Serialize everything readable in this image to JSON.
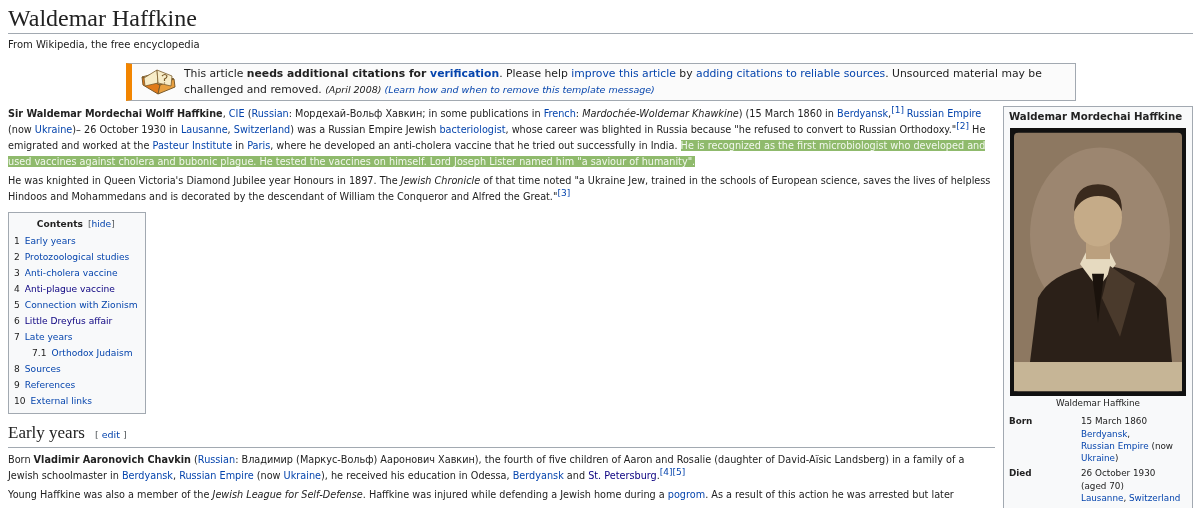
{
  "page": {
    "title": "Waldemar Haffkine",
    "tagline": "From Wikipedia, the free encyclopedia"
  },
  "notice": {
    "segments": [
      {
        "kind": "text",
        "text": "This article "
      },
      {
        "kind": "bold",
        "text": "needs additional citations for "
      },
      {
        "kind": "bold-link",
        "text": "verification"
      },
      {
        "kind": "text",
        "text": ". Please help "
      },
      {
        "kind": "link",
        "text": "improve this article"
      },
      {
        "kind": "text",
        "text": " by "
      },
      {
        "kind": "link",
        "text": "adding citations to reliable sources"
      },
      {
        "kind": "text",
        "text": ". Unsourced material may be challenged and removed. "
      },
      {
        "kind": "small-italic",
        "text": "(April 2008) "
      },
      {
        "kind": "small-link",
        "text": "(Learn how and when to remove this template message)"
      }
    ]
  },
  "intro": [
    {
      "segments": [
        {
          "kind": "bold",
          "text": "Sir Waldemar Mordechai Wolff Haffkine"
        },
        {
          "kind": "text",
          "text": ", "
        },
        {
          "kind": "link",
          "text": "CIE"
        },
        {
          "kind": "text",
          "text": " ("
        },
        {
          "kind": "link",
          "text": "Russian"
        },
        {
          "kind": "text",
          "text": ": Мордехай-Вольф Хавкин; in some publications in "
        },
        {
          "kind": "link",
          "text": "French"
        },
        {
          "kind": "text",
          "text": ": "
        },
        {
          "kind": "italic",
          "text": "Mardochée-Woldemar Khawkine"
        },
        {
          "kind": "text",
          "text": ") (15 March 1860 in "
        },
        {
          "kind": "link",
          "text": "Berdyansk"
        },
        {
          "kind": "text",
          "text": ","
        },
        {
          "kind": "citation",
          "text": "[1] "
        },
        {
          "kind": "link",
          "text": "Russian Empire"
        },
        {
          "kind": "text",
          "text": " (now "
        },
        {
          "kind": "link",
          "text": "Ukraine"
        },
        {
          "kind": "text",
          "text": ")– 26 October 1930 in "
        },
        {
          "kind": "link",
          "text": "Lausanne"
        },
        {
          "kind": "text",
          "text": ", "
        },
        {
          "kind": "link",
          "text": "Switzerland"
        },
        {
          "kind": "text",
          "text": ") was a Russian Empire Jewish "
        },
        {
          "kind": "link",
          "text": "bacteriologist"
        },
        {
          "kind": "text",
          "text": ", whose career was blighted in Russia because \"he refused to convert to Russian Orthodoxy.\""
        },
        {
          "kind": "citation",
          "text": "[2]"
        },
        {
          "kind": "text",
          "text": " He emigrated and worked at the "
        },
        {
          "kind": "link",
          "text": "Pasteur Institute"
        },
        {
          "kind": "text",
          "text": " in "
        },
        {
          "kind": "link",
          "text": "Paris"
        },
        {
          "kind": "text",
          "text": ", where he developed an anti-cholera vaccine that he tried out successfully in India. "
        },
        {
          "kind": "highlight",
          "text": "He is recognized as the first microbiologist who developed and used vaccines against cholera and bubonic plague. He tested the vaccines on himself. Lord Joseph Lister named him \"a saviour of humanity\"."
        }
      ]
    },
    {
      "segments": [
        {
          "kind": "text",
          "text": "He was knighted in Queen Victoria's Diamond Jubilee year Honours in 1897. The "
        },
        {
          "kind": "italic",
          "text": "Jewish Chronicle"
        },
        {
          "kind": "text",
          "text": " of that time noted \"a Ukraine Jew, trained in the schools of European science, saves the lives of helpless Hindoos and Mohammedans and is decorated by the descendant of William the Conqueror and Alfred the Great.\""
        },
        {
          "kind": "citation",
          "text": "[3]"
        }
      ]
    }
  ],
  "toc": {
    "title": "Contents",
    "toggle": {
      "open": "[",
      "label": "hide",
      "close": "]"
    },
    "items": [
      {
        "number": "1",
        "label": "Early years",
        "visited": false
      },
      {
        "number": "2",
        "label": "Protozoological studies",
        "visited": false
      },
      {
        "number": "3",
        "label": "Anti-cholera vaccine",
        "visited": false
      },
      {
        "number": "4",
        "label": "Anti-plague vaccine",
        "visited": true
      },
      {
        "number": "5",
        "label": "Connection with Zionism",
        "visited": false
      },
      {
        "number": "6",
        "label": "Little Dreyfus affair",
        "visited": true
      },
      {
        "number": "7",
        "label": "Late years",
        "visited": false,
        "children": [
          {
            "number": "7.1",
            "label": "Orthodox Judaism",
            "visited": false
          }
        ]
      },
      {
        "number": "8",
        "label": "Sources",
        "visited": false
      },
      {
        "number": "9",
        "label": "References",
        "visited": false
      },
      {
        "number": "10",
        "label": "External links",
        "visited": false
      }
    ]
  },
  "section": {
    "heading": "Early years",
    "edit": {
      "open": "[",
      "label": "edit",
      "close": "]"
    },
    "paragraphs": [
      {
        "segments": [
          {
            "kind": "text",
            "text": "Born "
          },
          {
            "kind": "bold",
            "text": "Vladimir Aaronovich Chavkin"
          },
          {
            "kind": "text",
            "text": " ("
          },
          {
            "kind": "link",
            "text": "Russian"
          },
          {
            "kind": "text",
            "text": ": Владимир (Маркус-Вольф) Ааронович Хавкин), the fourth of five children of Aaron and Rosalie (daughter of David-Aïsic Landsberg) in a family of a Jewish schoolmaster in "
          },
          {
            "kind": "link",
            "text": "Berdyansk"
          },
          {
            "kind": "text",
            "text": ", "
          },
          {
            "kind": "link",
            "text": "Russian Empire"
          },
          {
            "kind": "text",
            "text": " (now "
          },
          {
            "kind": "link",
            "text": "Ukraine"
          },
          {
            "kind": "text",
            "text": "), he received his education in Odessa, "
          },
          {
            "kind": "link",
            "text": "Berdyansk"
          },
          {
            "kind": "text",
            "text": " and "
          },
          {
            "kind": "visited-link",
            "text": "St. Petersburg"
          },
          {
            "kind": "text",
            "text": "."
          },
          {
            "kind": "citation",
            "text": "[4]"
          },
          {
            "kind": "citation",
            "text": "[5]"
          }
        ]
      },
      {
        "segments": [
          {
            "kind": "text",
            "text": "Young Haffkine was also a member of the "
          },
          {
            "kind": "italic",
            "text": "Jewish League for Self-Defense"
          },
          {
            "kind": "text",
            "text": ". Haffkine was injured while defending a Jewish home during a "
          },
          {
            "kind": "link",
            "text": "pogrom"
          },
          {
            "kind": "text",
            "text": ". As a result of this action he was arrested but later"
          }
        ]
      }
    ]
  },
  "infobox": {
    "title": "Waldemar Mordechai Haffkine",
    "caption": "Waldemar Haffkine",
    "rows": [
      {
        "label": "Born",
        "lines": [
          [
            {
              "kind": "text",
              "text": "15 March 1860"
            }
          ],
          [
            {
              "kind": "link",
              "text": "Berdyansk"
            },
            {
              "kind": "text",
              "text": ", "
            },
            {
              "kind": "link",
              "text": "Russian Empire"
            },
            {
              "kind": "text",
              "text": " (now "
            },
            {
              "kind": "link",
              "text": "Ukraine"
            },
            {
              "kind": "text",
              "text": ")"
            }
          ]
        ]
      },
      {
        "label": "Died",
        "lines": [
          [
            {
              "kind": "text",
              "text": "26 October 1930"
            }
          ],
          [
            {
              "kind": "text",
              "text": "(aged 70)"
            }
          ],
          [
            {
              "kind": "link",
              "text": "Lausanne"
            },
            {
              "kind": "text",
              "text": ", "
            },
            {
              "kind": "link",
              "text": "Switzerland"
            }
          ]
        ]
      }
    ]
  }
}
